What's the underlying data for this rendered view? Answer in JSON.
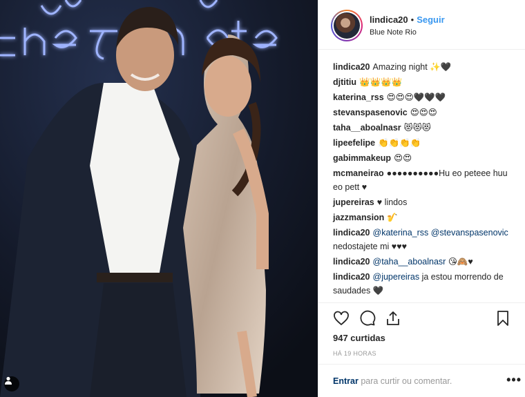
{
  "header": {
    "username": "lindica20",
    "separator": "•",
    "follow_label": "Seguir",
    "location": "Blue Note Rio"
  },
  "photo": {
    "neon_sign_text": "Blue Note",
    "tag_icon": "person-icon"
  },
  "comments": [
    {
      "user": "lindica20",
      "text": "Amazing night ✨🖤"
    },
    {
      "user": "djtitiu",
      "text": "👑👑👑👑"
    },
    {
      "user": "katerina_rss",
      "text": "😍😍😍🖤🖤🖤"
    },
    {
      "user": "stevanspasenovic",
      "text": "😍😍😍"
    },
    {
      "user": "taha__aboalnasr",
      "text": "😻😻😻"
    },
    {
      "user": "lipeefelipe",
      "text": "👏👏👏👏"
    },
    {
      "user": "gabimmakeup",
      "text": "😍😍"
    },
    {
      "user": "mcmaneirao",
      "text": "●●●●●●●●●●Hu eo peteee huu eo pett ♥"
    },
    {
      "user": "jupereiras",
      "text": "♥ lindos"
    },
    {
      "user": "jazzmansion",
      "text": "🎷"
    },
    {
      "user": "lindica20",
      "mention": "@katerina_rss @stevanspasenovic",
      "text": "nedostajete mi ♥♥♥"
    },
    {
      "user": "lindica20",
      "mention": "@taha__aboalnasr",
      "text": "😘🙈♥"
    },
    {
      "user": "lindica20",
      "mention": "@jupereiras",
      "text": "ja estou morrendo de saudades 🖤"
    }
  ],
  "actions": {
    "like_icon": "heart-icon",
    "comment_icon": "comment-icon",
    "share_icon": "share-icon",
    "save_icon": "bookmark-icon"
  },
  "likes_text": "947 curtidas",
  "time_ago": "Há 19 horas",
  "footer": {
    "login_link": "Entrar",
    "login_rest": "para curtir ou comentar.",
    "more_label": "•••"
  },
  "colors": {
    "link_blue": "#3897f0",
    "mention_blue": "#003569",
    "neon_blue": "#6e8cff",
    "muted": "#999999"
  }
}
